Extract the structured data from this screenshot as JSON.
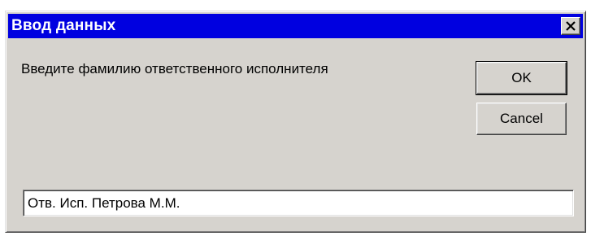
{
  "window": {
    "title": "Ввод данных",
    "close_icon": "close-icon"
  },
  "dialog": {
    "prompt": "Введите фамилию ответственного исполнителя",
    "ok_label": "OK",
    "cancel_label": "Cancel",
    "input_value": "Отв. Исп. Петрова М.М."
  },
  "colors": {
    "titlebar": "#0000e0",
    "window_bg": "#d6d3ce",
    "title_text": "#ffffff"
  }
}
